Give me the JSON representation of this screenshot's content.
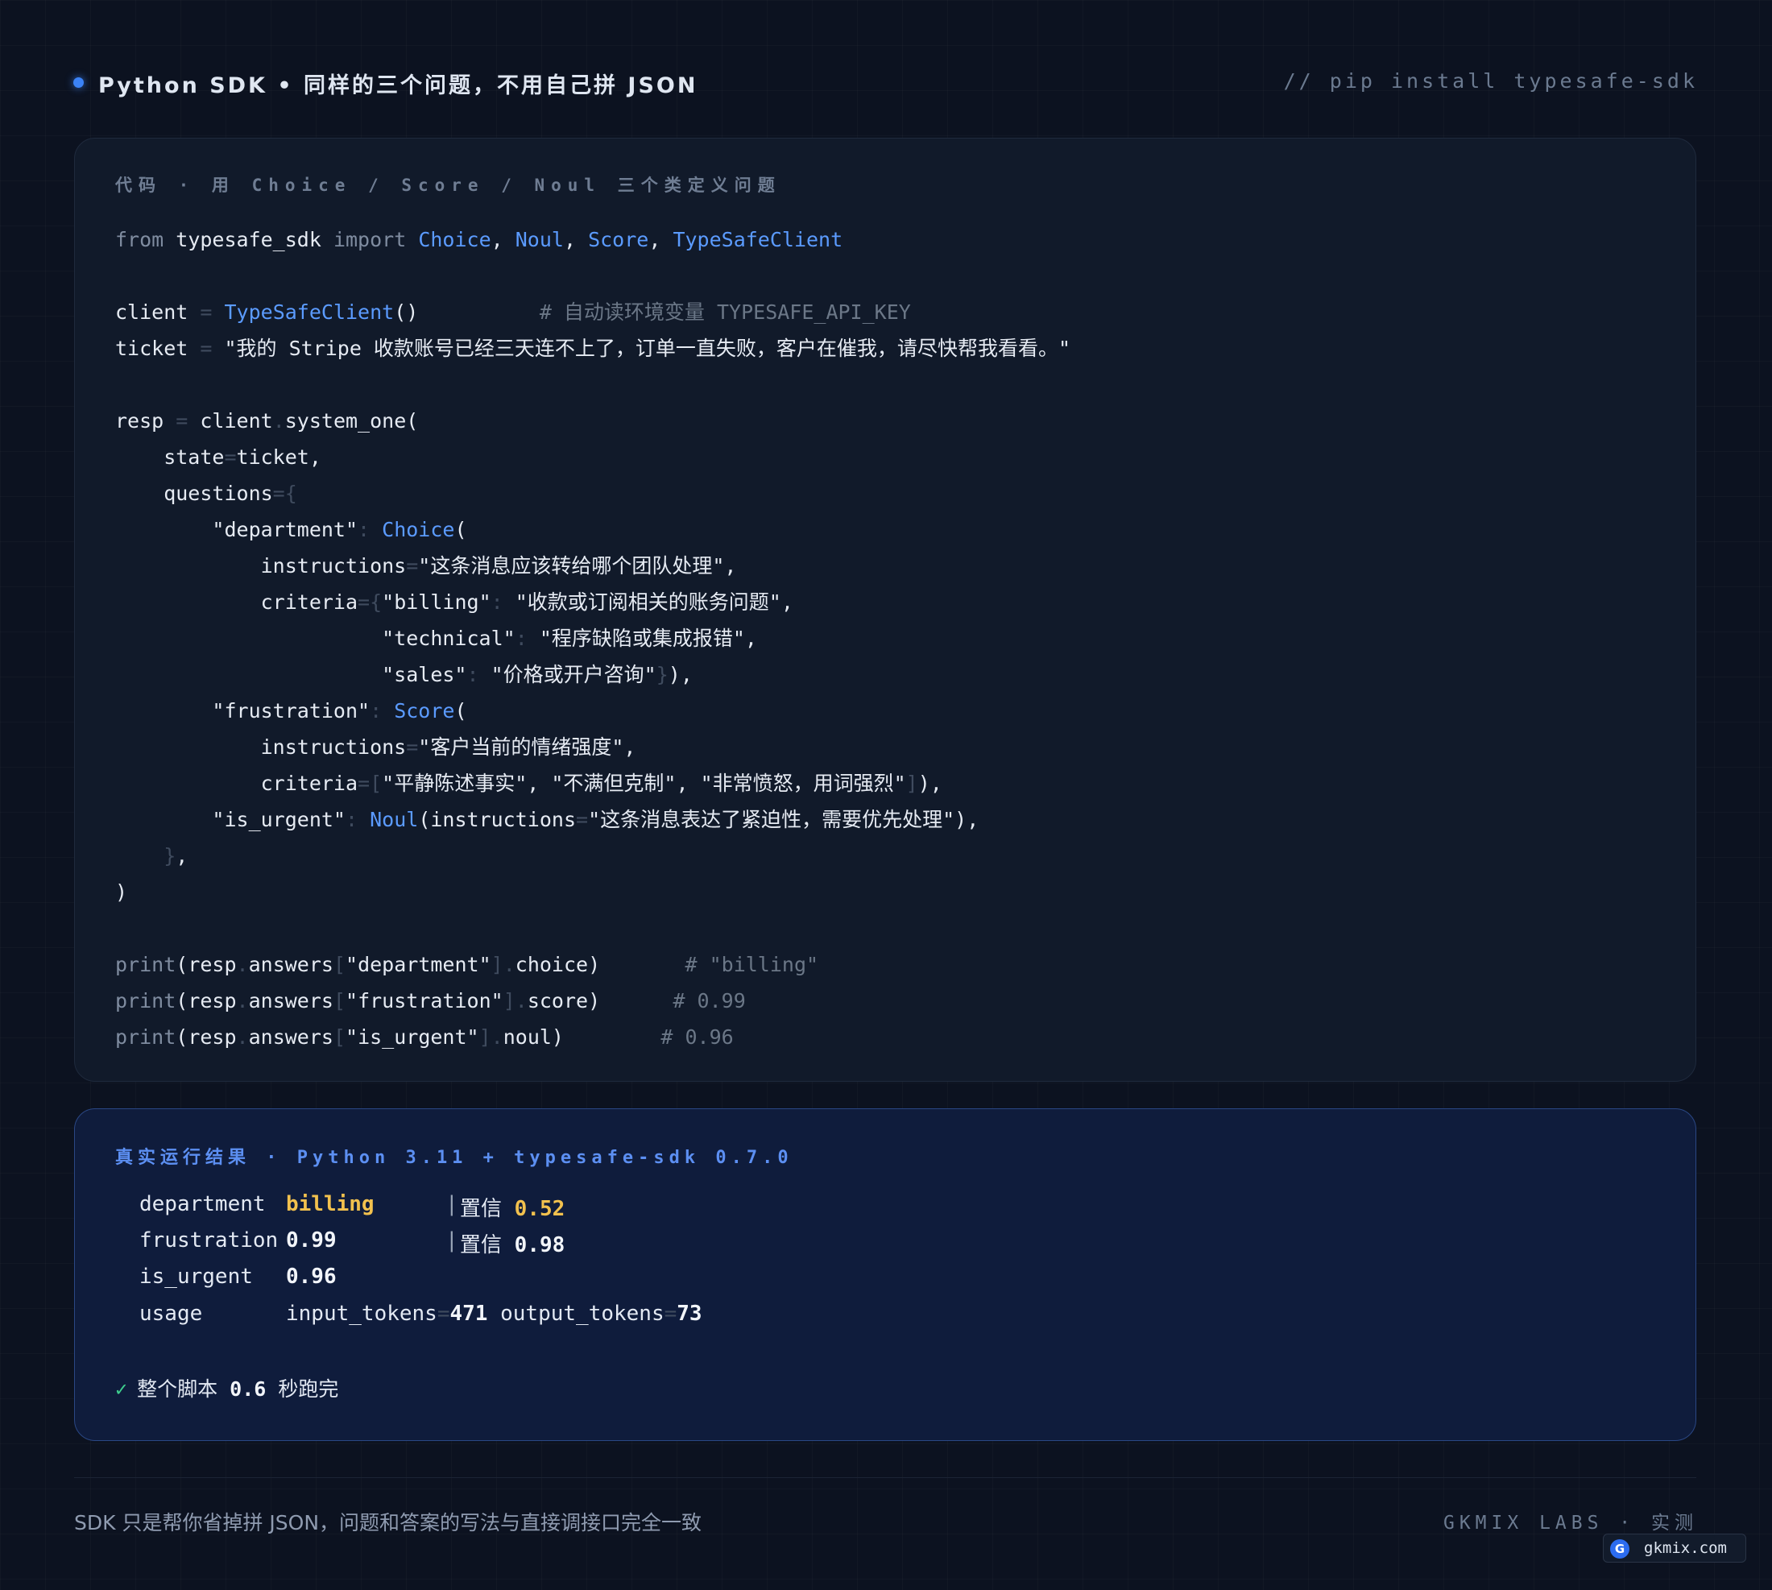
{
  "header": {
    "title": "Python SDK • 同样的三个问题，不用自己拼 JSON",
    "install_cmd": "// pip install typesafe-sdk"
  },
  "code_card": {
    "label": "代码 · 用 Choice / Score / Noul 三个类定义问题",
    "lines": [
      "from typesafe_sdk import Choice, Noul, Score, TypeSafeClient",
      "",
      "client = TypeSafeClient()          # 自动读环境变量 TYPESAFE_API_KEY",
      "ticket = \"我的 Stripe 收款账号已经三天连不上了，订单一直失败，客户在催我，请尽快帮我看看。\"",
      "",
      "resp = client.system_one(",
      "    state=ticket,",
      "    questions={",
      "        \"department\": Choice(",
      "            instructions=\"这条消息应该转给哪个团队处理\",",
      "            criteria={\"billing\": \"收款或订阅相关的账务问题\",",
      "                      \"technical\": \"程序缺陷或集成报错\",",
      "                      \"sales\": \"价格或开户咨询\"}),",
      "        \"frustration\": Score(",
      "            instructions=\"客户当前的情绪强度\",",
      "            criteria=[\"平静陈述事实\", \"不满但克制\", \"非常愤怒，用词强烈\"]),",
      "        \"is_urgent\": Noul(instructions=\"这条消息表达了紧迫性，需要优先处理\"),",
      "    },",
      ")",
      "",
      "print(resp.answers[\"department\"].choice)       # \"billing\"",
      "print(resp.answers[\"frustration\"].score)      # 0.99",
      "print(resp.answers[\"is_urgent\"].noul)        # 0.96"
    ]
  },
  "result_card": {
    "label": "真实运行结果 · Python 3.11 + typesafe-sdk 0.7.0",
    "rows": {
      "department": {
        "key": "department",
        "value": "billing",
        "separator": "|",
        "conf_label": "置信",
        "conf_value": "0.52"
      },
      "frustration": {
        "key": "frustration",
        "value": "0.99",
        "separator": "|",
        "conf_label": "置信",
        "conf_value": "0.98"
      },
      "is_urgent": {
        "key": "is_urgent",
        "value": "0.96"
      },
      "usage": {
        "key": "usage",
        "input_label": "input_tokens",
        "input_value": "471",
        "output_label": "output_tokens",
        "output_value": "73"
      }
    },
    "done": {
      "check": "✓",
      "prefix": "整个脚本",
      "value": "0.6",
      "suffix": "秒跑完"
    }
  },
  "footer": {
    "note": "SDK 只是帮你省掉拼 JSON，问题和答案的写法与直接调接口完全一致",
    "brand": "GKMIX LABS · 实测",
    "site_logo": "G",
    "site": "gkmix.com"
  },
  "colors": {
    "background": "#0c1220",
    "accent_blue": "#5b9bff",
    "highlight_yellow": "#f2c14e",
    "success_green": "#3ecf8e"
  }
}
